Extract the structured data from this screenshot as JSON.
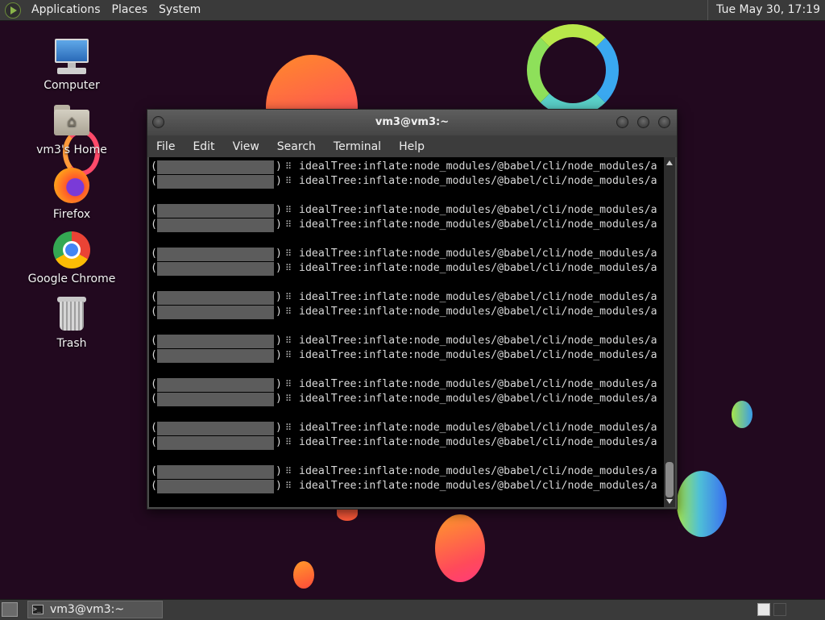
{
  "top_panel": {
    "menus": [
      "Applications",
      "Places",
      "System"
    ],
    "clock": "Tue May 30, 17:19"
  },
  "desktop": {
    "icons": [
      {
        "label": "Computer",
        "icon": "computer-icon"
      },
      {
        "label": "vm3's Home",
        "icon": "home-folder-icon"
      },
      {
        "label": "Firefox",
        "icon": "firefox-icon"
      },
      {
        "label": "Google Chrome",
        "icon": "chrome-icon"
      },
      {
        "label": "Trash",
        "icon": "trash-icon"
      }
    ]
  },
  "terminal": {
    "title": "vm3@vm3:~",
    "menus": [
      "File",
      "Edit",
      "View",
      "Search",
      "Terminal",
      "Help"
    ],
    "open_paren": "(",
    "close_paren": ")",
    "spinner": "⠿",
    "line_text": "idealTree:inflate:node_modules/@babel/cli/node_modules/a"
  },
  "taskbar": {
    "task_label": "vm3@vm3:~"
  },
  "colors": {
    "wallpaper": "#22091f",
    "panel": "#3a3a3a",
    "terminal_bg": "#000000",
    "terminal_fg": "#d8d8d8",
    "redaction": "#5c5c5c"
  }
}
